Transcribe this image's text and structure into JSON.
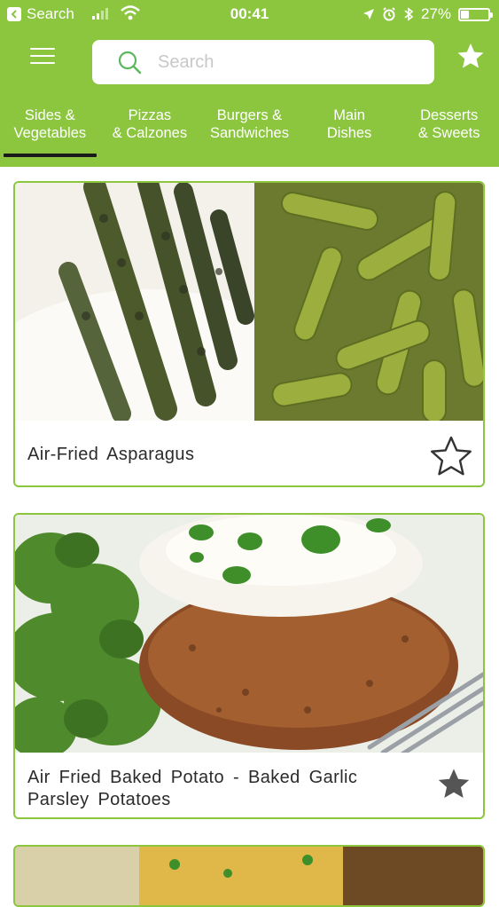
{
  "status": {
    "back_app": "Search",
    "time": "00:41",
    "battery": "27%",
    "battery_level": 0.27
  },
  "header": {
    "search_placeholder": "Search"
  },
  "tabs": [
    {
      "label": "Sides &\nVegetables",
      "active": true
    },
    {
      "label": "Pizzas\n& Calzones",
      "active": false
    },
    {
      "label": "Burgers &\nSandwiches",
      "active": false
    },
    {
      "label": "Main\nDishes",
      "active": false
    },
    {
      "label": "Desserts\n& Sweets",
      "active": false
    }
  ],
  "recipes": [
    {
      "title": "Air-Fried Asparagus",
      "favorite": false
    },
    {
      "title": "Air Fried Baked Potato - Baked Garlic Parsley Potatoes",
      "favorite": true
    }
  ],
  "colors": {
    "brand_green": "#8cc63f",
    "tab_indicator": "#1a1a1a",
    "favorite_filled": "#555555"
  }
}
